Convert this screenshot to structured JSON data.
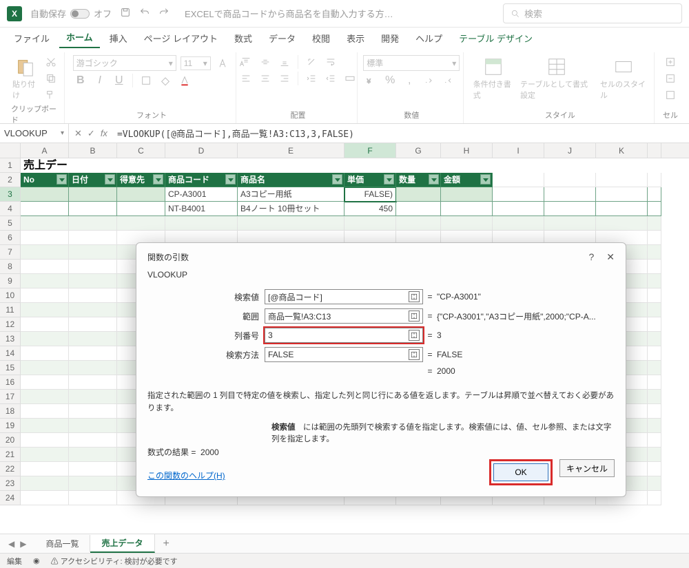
{
  "titlebar": {
    "autosave_label": "自動保存",
    "autosave_state": "オフ",
    "doc_title": "EXCELで商品コードから商品名を自動入力する方…",
    "search_placeholder": "検索"
  },
  "tabs": {
    "file": "ファイル",
    "home": "ホーム",
    "insert": "挿入",
    "layout": "ページ レイアウト",
    "formulas": "数式",
    "data": "データ",
    "review": "校閲",
    "view": "表示",
    "developer": "開発",
    "help": "ヘルプ",
    "table": "テーブル デザイン"
  },
  "ribbon": {
    "paste": "貼り付け",
    "clipboard": "クリップボード",
    "font_name": "游ゴシック",
    "font_size": "11",
    "font": "フォント",
    "alignment": "配置",
    "number_format": "標準",
    "number": "数値",
    "cond_format": "条件付き書式",
    "table_format": "テーブルとして書式設定",
    "cell_style": "セルのスタイル",
    "styles": "スタイル",
    "cells": "セル"
  },
  "formula_bar": {
    "name": "VLOOKUP",
    "formula": "=VLOOKUP([@商品コード],商品一覧!A3:C13,3,FALSE)"
  },
  "columns": [
    "A",
    "B",
    "C",
    "D",
    "E",
    "F",
    "G",
    "H",
    "I",
    "J",
    "K"
  ],
  "spreadsheet": {
    "title": "売上データ",
    "headers": {
      "no": "No",
      "date": "日付",
      "customer": "得意先",
      "code": "商品コード",
      "name": "商品名",
      "price": "単価",
      "qty": "数量",
      "amount": "金額"
    },
    "rows": [
      {
        "code": "CP-A3001",
        "name": "A3コピー用紙",
        "price": "FALSE)"
      },
      {
        "code": "NT-B4001",
        "name": "B4ノート 10冊セット",
        "price": "450"
      }
    ]
  },
  "dialog": {
    "title": "関数の引数",
    "func": "VLOOKUP",
    "args": {
      "lookup": {
        "label": "検索値",
        "value": "[@商品コード]",
        "result": "\"CP-A3001\""
      },
      "range": {
        "label": "範囲",
        "value": "商品一覧!A3:C13",
        "result": "{\"CP-A3001\",\"A3コピー用紙\",2000;\"CP-A..."
      },
      "col": {
        "label": "列番号",
        "value": "3",
        "result": "3"
      },
      "match": {
        "label": "検索方法",
        "value": "FALSE",
        "result": "FALSE"
      }
    },
    "preview_eq": "=",
    "preview": "2000",
    "desc1": "指定された範囲の 1 列目で特定の値を検索し、指定した列と同じ行にある値を返します。テーブルは昇順で並べ替えておく必要があります。",
    "desc2_label": "検索値",
    "desc2": "には範囲の先頭列で検索する値を指定します。検索値には、値、セル参照、または文字列を指定します。",
    "result_label": "数式の結果 =",
    "result": "2000",
    "help": "この関数のヘルプ(H)",
    "ok": "OK",
    "cancel": "キャンセル"
  },
  "sheets": {
    "s1": "商品一覧",
    "s2": "売上データ"
  },
  "status": {
    "mode": "編集",
    "acc_label": "アクセシビリティ: 検討が必要です"
  }
}
